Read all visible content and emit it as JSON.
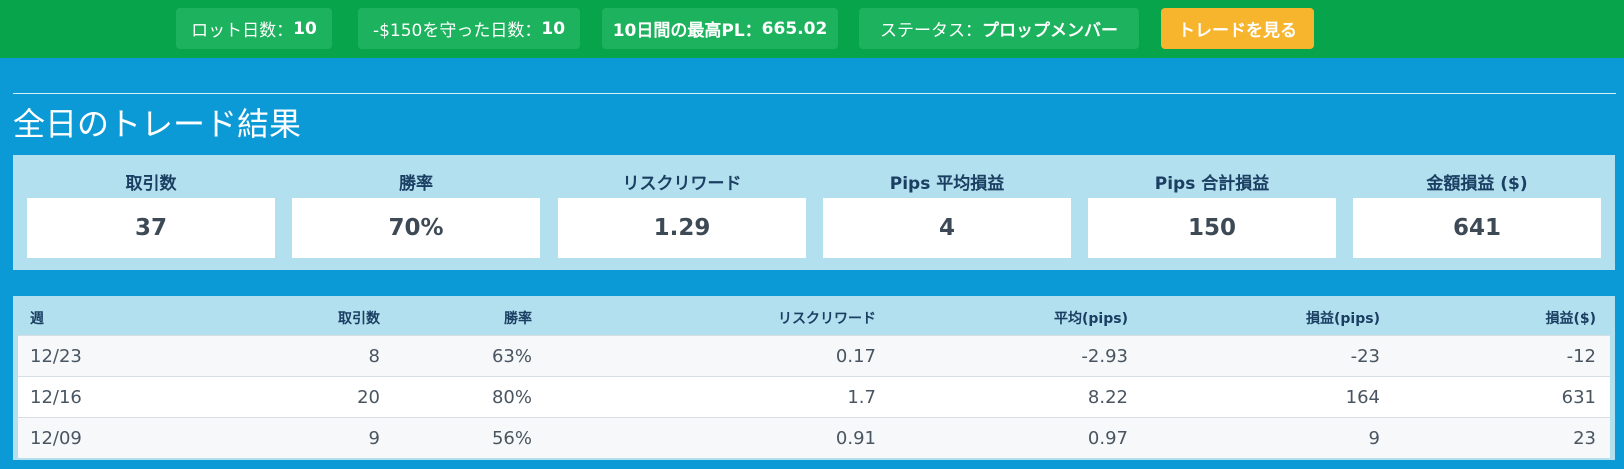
{
  "topbar": {
    "lot_days_label": "ロット日数：",
    "lot_days_value": "10",
    "protected_days_label": "-$150を守った日数：",
    "protected_days_value": "10",
    "max_pl_label": "10日間の最高PL：",
    "max_pl_value": "665.02",
    "status_label": "ステータス：",
    "status_value": "プロップメンバー",
    "view_trades_button": "トレードを見る"
  },
  "colors": {
    "topbar_bg": "#07a44b",
    "pill_bg": "#1db25d",
    "button_bg": "#f6b52c",
    "page_bg": "#0b9ad6",
    "panel_bg": "#b3e0ee"
  },
  "section_title": "全日のトレード結果",
  "stats": [
    {
      "label": "取引数",
      "value": "37"
    },
    {
      "label": "勝率",
      "value": "70%"
    },
    {
      "label": "リスクリワード",
      "value": "1.29"
    },
    {
      "label": "Pips 平均損益",
      "value": "4"
    },
    {
      "label": "Pips 合計損益",
      "value": "150"
    },
    {
      "label": "金額損益 ($)",
      "value": "641"
    }
  ],
  "weekly_table": {
    "headers": [
      "週",
      "取引数",
      "勝率",
      "リスクリワード",
      "平均(pips)",
      "損益(pips)",
      "損益($)"
    ],
    "rows": [
      [
        "12/23",
        "8",
        "63%",
        "0.17",
        "-2.93",
        "-23",
        "-12"
      ],
      [
        "12/16",
        "20",
        "80%",
        "1.7",
        "8.22",
        "164",
        "631"
      ],
      [
        "12/09",
        "9",
        "56%",
        "0.91",
        "0.97",
        "9",
        "23"
      ]
    ]
  }
}
